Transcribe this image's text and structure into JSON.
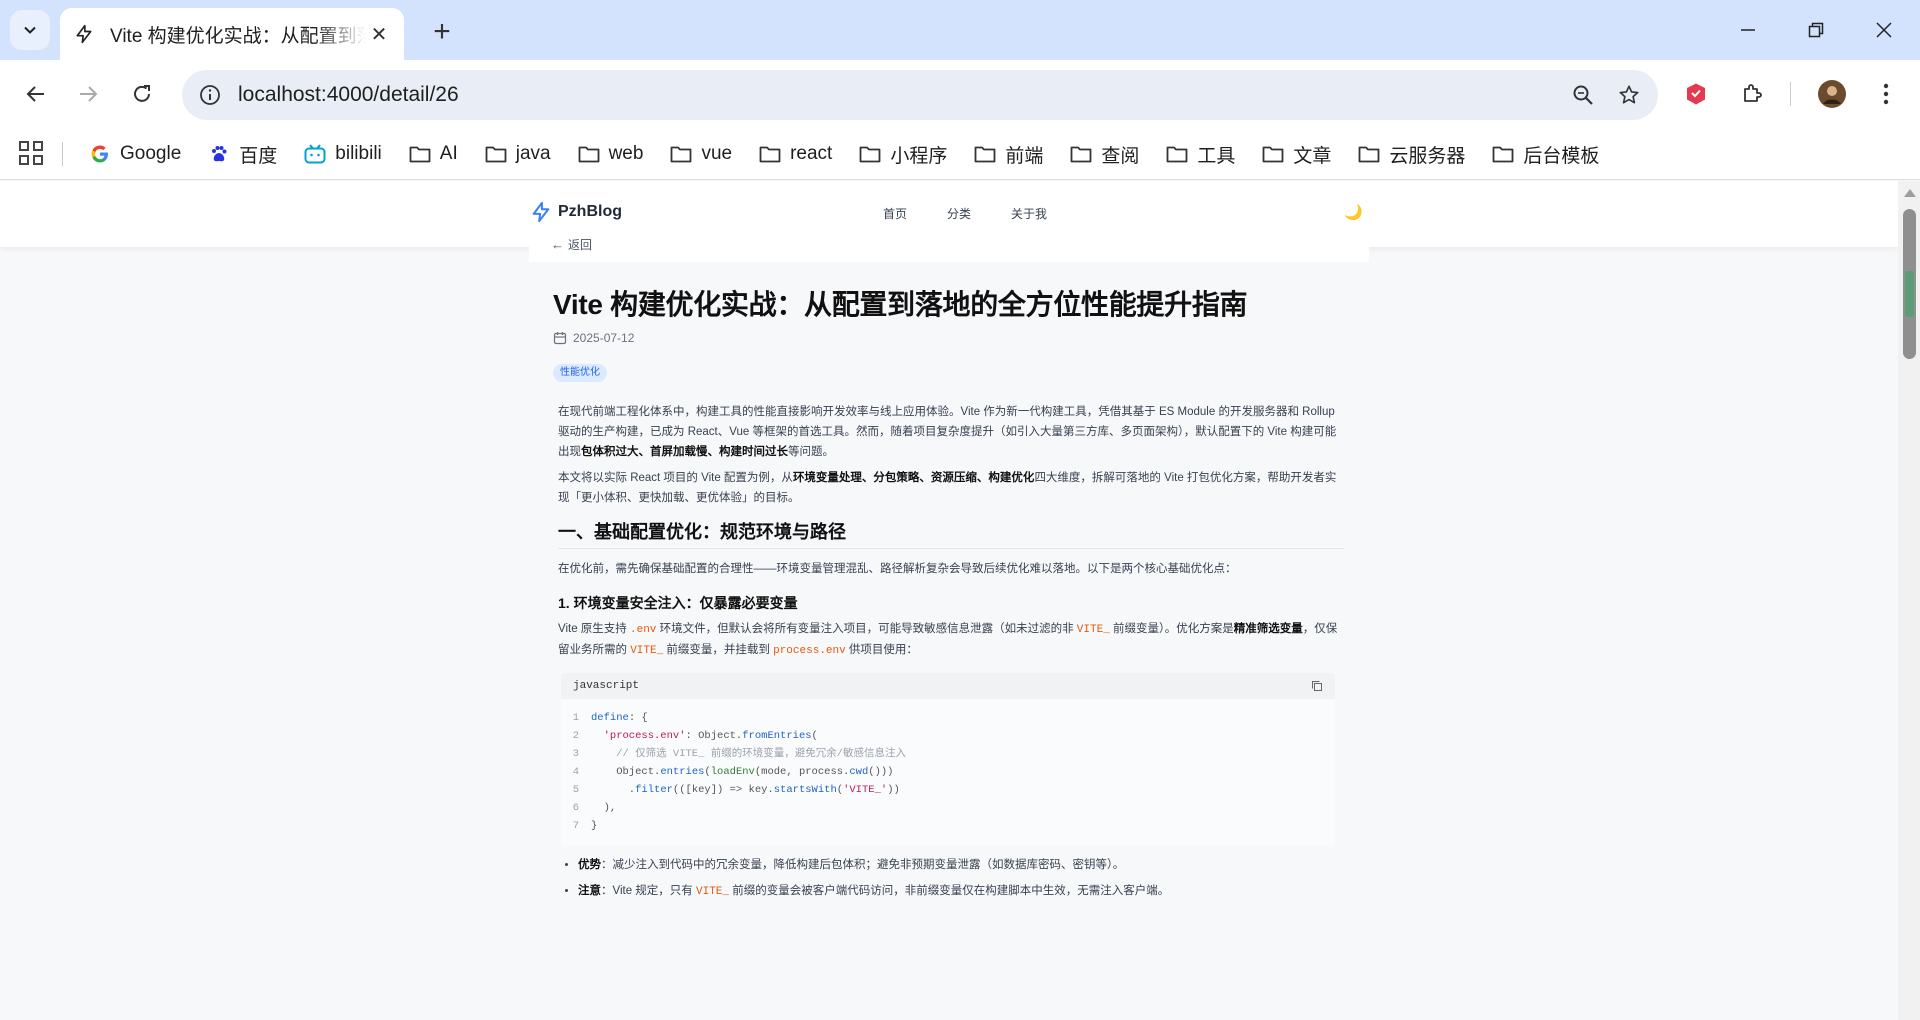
{
  "browser": {
    "tab_title": "Vite 构建优化实战：从配置到落地的全方位性能提升指南",
    "url": "localhost:4000/detail/26",
    "bookmarks": [
      {
        "label": "Google",
        "icon": "google-icon"
      },
      {
        "label": "百度",
        "icon": "baidu-icon"
      },
      {
        "label": "bilibili",
        "icon": "bilibili-icon"
      },
      {
        "label": "AI",
        "icon": "folder-icon"
      },
      {
        "label": "java",
        "icon": "folder-icon"
      },
      {
        "label": "web",
        "icon": "folder-icon"
      },
      {
        "label": "vue",
        "icon": "folder-icon"
      },
      {
        "label": "react",
        "icon": "folder-icon"
      },
      {
        "label": "小程序",
        "icon": "folder-icon"
      },
      {
        "label": "前端",
        "icon": "folder-icon"
      },
      {
        "label": "查阅",
        "icon": "folder-icon"
      },
      {
        "label": "工具",
        "icon": "folder-icon"
      },
      {
        "label": "文章",
        "icon": "folder-icon"
      },
      {
        "label": "云服务器",
        "icon": "folder-icon"
      },
      {
        "label": "后台模板",
        "icon": "folder-icon"
      }
    ]
  },
  "site": {
    "logo": "PzhBlog",
    "nav": [
      "首页",
      "分类",
      "关于我"
    ],
    "theme_icon": "🌙",
    "back_label": "返回"
  },
  "article": {
    "title": "Vite 构建优化实战：从配置到落地的全方位性能提升指南",
    "date": "2025-07-12",
    "tag": "性能优化",
    "p1_a": "在现代前端工程化体系中，构建工具的性能直接影响开发效率与线上应用体验。Vite 作为新一代构建工具，凭借其基于 ES Module 的开发服务器和 Rollup 驱动的生产构建，已成为 React、Vue 等框架的首选工具。然而，随着项目复杂度提升（如引入大量第三方库、多页面架构），默认配置下的 Vite 构建可能出现",
    "p1_b": "包体积过大、首屏加载慢、构建时间过长",
    "p1_c": "等问题。",
    "p2_a": "本文将以实际 React 项目的 Vite 配置为例，从",
    "p2_b": "环境变量处理、分包策略、资源压缩、构建优化",
    "p2_c": "四大维度，拆解可落地的 Vite 打包优化方案，帮助开发者实现「更小体积、更快加载、更优体验」的目标。",
    "h2": "一、基础配置优化：规范环境与路径",
    "p3": "在优化前，需先确保基础配置的合理性——环境变量管理混乱、路径解析复杂会导致后续优化难以落地。以下是两个核心基础优化点：",
    "h3": "1. 环境变量安全注入：仅暴露必要变量",
    "p4_a": "Vite 原生支持 ",
    "p4_code1": ".env",
    "p4_b": " 环境文件，但默认会将所有变量注入项目，可能导致敏感信息泄露（如未过滤的非 ",
    "p4_code2": "VITE_",
    "p4_c": " 前缀变量）。优化方案是",
    "p4_bold": "精准筛选变量",
    "p4_d": "，仅保留业务所需的 ",
    "p4_code3": "VITE_",
    "p4_e": " 前缀变量，并挂载到 ",
    "p4_code4": "process.env",
    "p4_f": " 供项目使用：",
    "code_lang": "javascript",
    "code_lines": [
      "1",
      "2",
      "3",
      "4",
      "5",
      "6",
      "7"
    ],
    "li1_label": "优势",
    "li1_text": "：减少注入到代码中的冗余变量，降低构建后包体积；避免非预期变量泄露（如数据库密码、密钥等）。",
    "li2_label": "注意",
    "li2_a": "：Vite 规定，只有 ",
    "li2_code": "VITE_",
    "li2_b": " 前缀的变量会被客户端代码访问，非前缀变量仅在构建脚本中生效，无需注入客户端。"
  }
}
